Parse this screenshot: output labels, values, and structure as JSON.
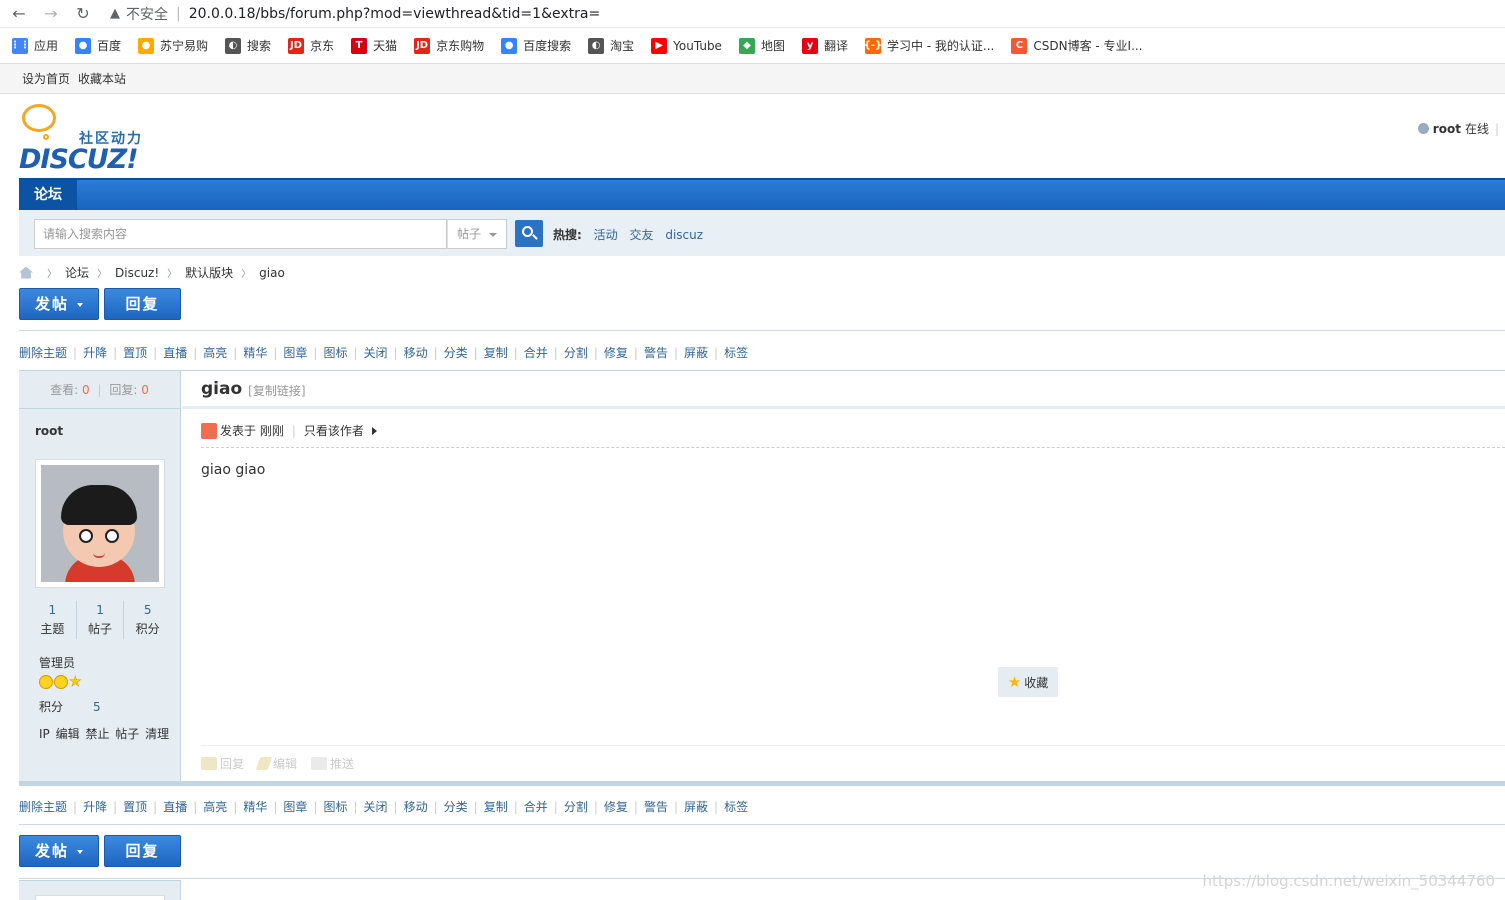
{
  "browser": {
    "security": "不安全",
    "url": "20.0.0.18/bbs/forum.php?mod=viewthread&tid=1&extra=",
    "bookmarks": [
      {
        "label": "应用",
        "icon": "apps-grid-icon",
        "color": "#4285f4"
      },
      {
        "label": "百度",
        "icon": "baidu-paw-icon",
        "color": "#3385ff"
      },
      {
        "label": "苏宁易购",
        "icon": "suning-icon",
        "color": "#ffaa00"
      },
      {
        "label": "搜索",
        "icon": "globe-icon",
        "color": "#555555"
      },
      {
        "label": "京东",
        "icon": "jd-icon",
        "color": "#e1251b"
      },
      {
        "label": "天猫",
        "icon": "tmall-icon",
        "color": "#d70012"
      },
      {
        "label": "京东购物",
        "icon": "jd-icon",
        "color": "#e1251b"
      },
      {
        "label": "百度搜索",
        "icon": "baidu-paw-icon",
        "color": "#3385ff"
      },
      {
        "label": "淘宝",
        "icon": "globe-icon",
        "color": "#555555"
      },
      {
        "label": "YouTube",
        "icon": "youtube-icon",
        "color": "#ff0000"
      },
      {
        "label": "地图",
        "icon": "map-pin-icon",
        "color": "#34a853"
      },
      {
        "label": "翻译",
        "icon": "youdao-icon",
        "color": "#e60012"
      },
      {
        "label": "学习中 - 我的认证...",
        "icon": "code-bracket-icon",
        "color": "#ff6a00"
      },
      {
        "label": "CSDN博客 - 专业I...",
        "icon": "csdn-icon",
        "color": "#fc5531"
      }
    ],
    "bookmark_glyphs": [
      "⋮⋮",
      "●",
      "●",
      "◐",
      "JD",
      "T",
      "JD",
      "●",
      "◐",
      "▶",
      "◆",
      "y",
      "{-}",
      "C"
    ]
  },
  "sitebar": {
    "set_home": "设为首页",
    "bookmark_site": "收藏本站"
  },
  "header": {
    "logo_cn": "社区动力",
    "logo_en": "DISCUZ!",
    "username": "root",
    "status": "在线",
    "divider": "|"
  },
  "nav": {
    "forum_tab": "论坛"
  },
  "search": {
    "placeholder": "请输入搜索内容",
    "type": "帖子",
    "hot_label": "热搜:",
    "hot_terms": [
      "活动",
      "交友",
      "discuz"
    ]
  },
  "breadcrumb": {
    "items": [
      "论坛",
      "Discuz!",
      "默认版块",
      "giao"
    ]
  },
  "buttons": {
    "post": "发帖",
    "reply": "回复"
  },
  "mod_actions": [
    "删除主题",
    "升降",
    "置顶",
    "直播",
    "高亮",
    "精华",
    "图章",
    "图标",
    "关闭",
    "移动",
    "分类",
    "复制",
    "合并",
    "分割",
    "修复",
    "警告",
    "屏蔽",
    "标签"
  ],
  "thread": {
    "views_label": "查看:",
    "views": "0",
    "replies_label": "回复:",
    "replies": "0",
    "title": "giao",
    "copy_link": "[复制链接]",
    "posted": "发表于 刚刚",
    "only_author": "只看该作者",
    "content": "giao giao",
    "favorite": "收藏",
    "foot_actions": [
      "回复",
      "编辑",
      "推送"
    ]
  },
  "author": {
    "name": "root",
    "stats": [
      {
        "num": "1",
        "label": "主题"
      },
      {
        "num": "1",
        "label": "帖子"
      },
      {
        "num": "5",
        "label": "积分"
      }
    ],
    "group": "管理员",
    "score_label": "积分",
    "score": "5",
    "actions": [
      "IP",
      "编辑",
      "禁止",
      "帖子",
      "清理"
    ]
  },
  "watermark": "https://blog.csdn.net/weixin_50344760"
}
